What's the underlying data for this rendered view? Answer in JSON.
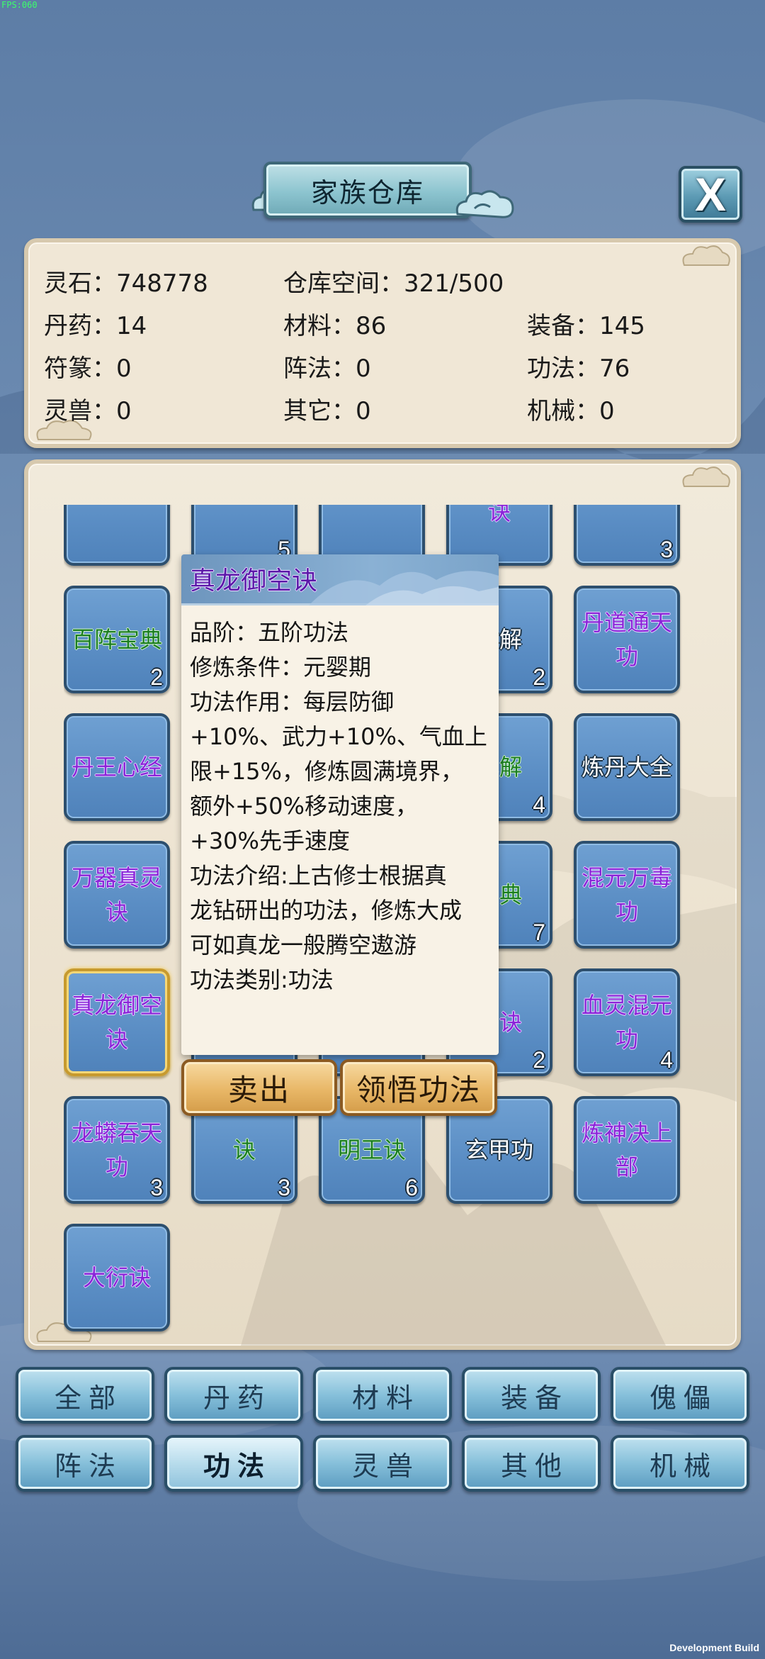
{
  "fps": "FPS:060",
  "build_label": "Development Build",
  "title": "家族仓库",
  "close_label": "X",
  "stats": {
    "spirit_stone": "灵石：748778",
    "storage": "仓库空间：321/500",
    "pills": "丹药：14",
    "materials": "材料：86",
    "equipment": "装备：145",
    "talismans": "符篆：0",
    "formations": "阵法：0",
    "techniques": "功法：76",
    "beasts": "灵兽：0",
    "others": "其它：0",
    "machines": "机械：0"
  },
  "grid": [
    {
      "name": "",
      "qty": "",
      "quality": "white"
    },
    {
      "name": "",
      "qty": "5",
      "quality": "white"
    },
    {
      "name": "",
      "qty": "",
      "quality": "white"
    },
    {
      "name": "诀",
      "qty": "",
      "quality": "purple"
    },
    {
      "name": "",
      "qty": "3",
      "quality": "white"
    },
    {
      "name": "百阵宝典",
      "qty": "2",
      "quality": "green"
    },
    {
      "name": "",
      "qty": "",
      "quality": "white"
    },
    {
      "name": "",
      "qty": "",
      "quality": "white"
    },
    {
      "name": "详解",
      "qty": "2",
      "quality": "white"
    },
    {
      "name": "丹道通天功",
      "qty": "",
      "quality": "purple"
    },
    {
      "name": "丹王心经",
      "qty": "",
      "quality": "purple"
    },
    {
      "name": "",
      "qty": "",
      "quality": "white"
    },
    {
      "name": "",
      "qty": "",
      "quality": "white"
    },
    {
      "name": "真解",
      "qty": "4",
      "quality": "green"
    },
    {
      "name": "炼丹大全",
      "qty": "",
      "quality": "white"
    },
    {
      "name": "万器真灵诀",
      "qty": "",
      "quality": "purple"
    },
    {
      "name": "",
      "qty": "",
      "quality": "white"
    },
    {
      "name": "",
      "qty": "",
      "quality": "white"
    },
    {
      "name": "宝典",
      "qty": "7",
      "quality": "green"
    },
    {
      "name": "混元万毒功",
      "qty": "",
      "quality": "purple"
    },
    {
      "name": "真龙御空诀",
      "qty": "",
      "quality": "purple",
      "selected": true
    },
    {
      "name": "",
      "qty": "",
      "quality": "white"
    },
    {
      "name": "",
      "qty": "",
      "quality": "white"
    },
    {
      "name": "神诀",
      "qty": "2",
      "quality": "purple"
    },
    {
      "name": "血灵混元功",
      "qty": "4",
      "quality": "purple"
    },
    {
      "name": "龙蟒吞天功",
      "qty": "3",
      "quality": "purple"
    },
    {
      "name": "诀",
      "qty": "3",
      "quality": "green"
    },
    {
      "name": "明王诀",
      "qty": "6",
      "quality": "green"
    },
    {
      "name": "玄甲功",
      "qty": "",
      "quality": "white"
    },
    {
      "name": "炼神决上部",
      "qty": "",
      "quality": "purple"
    },
    {
      "name": "大衍诀",
      "qty": "",
      "quality": "purple"
    }
  ],
  "tooltip": {
    "title": "真龙御空诀",
    "lines": [
      "品阶：五阶功法",
      "修炼条件：元婴期",
      "功法作用：每层防御",
      "+10%、武力+10%、气血上",
      "限+15%，修炼圆满境界，",
      "额外+50%移动速度，",
      "+30%先手速度",
      "功法介绍:上古修士根据真",
      "龙钻研出的功法，修炼大成",
      "可如真龙一般腾空遨游",
      "功法类别:功法"
    ]
  },
  "actions": {
    "sell": "卖出",
    "comprehend": "领悟功法"
  },
  "tabs": [
    {
      "label": "全部"
    },
    {
      "label": "丹药"
    },
    {
      "label": "材料"
    },
    {
      "label": "装备"
    },
    {
      "label": "傀儡"
    },
    {
      "label": "阵法"
    },
    {
      "label": "功法",
      "active": true
    },
    {
      "label": "灵兽"
    },
    {
      "label": "其他"
    },
    {
      "label": "机械"
    }
  ]
}
